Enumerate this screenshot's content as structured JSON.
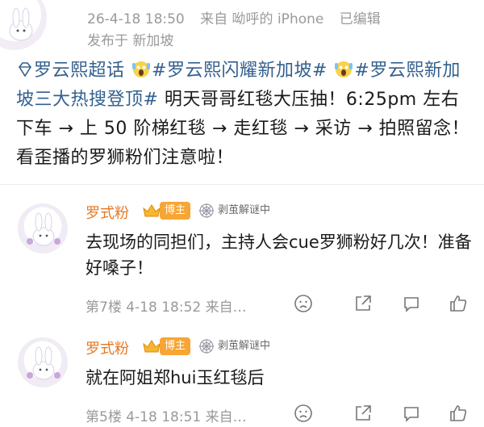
{
  "post": {
    "meta": {
      "time": "26-4-18 18:50",
      "source": "来自 呦呼的 iPhone",
      "edited": "已编辑",
      "published": "发布于 新加坡"
    },
    "body": {
      "seg1": "罗云熙超话",
      "seg2": "#罗云熙闪耀新加坡#",
      "seg3": "#罗云熙新加坡三大热搜登顶#",
      "seg4": " 明天哥哥红毯大压抽！6:25pm 左右下车 → 上 50 阶梯红毯 → 走红毯 → 采访 → 拍照留念！看歪播的罗狮粉们注意啦！"
    }
  },
  "comments": [
    {
      "name": "罗式粉",
      "badge": "博主",
      "group": "剥茧解谜中",
      "text": "去现场的同担们，主持人会cue罗狮粉好几次！准备好嗓子！",
      "floor": "第7楼",
      "time": "4-18 18:52",
      "source": "来自…"
    },
    {
      "name": "罗式粉",
      "badge": "博主",
      "group": "剥茧解谜中",
      "text": "就在阿姐郑hui玉红毯后",
      "floor": "第5楼",
      "time": "4-18 18:51",
      "source": "来自…"
    }
  ],
  "icons": {
    "diamond": "diamond-icon",
    "emoji": "scream-emoji-icon",
    "crown": "crown-icon",
    "spider": "spider-web-icon",
    "sad": "sad-face-icon",
    "share": "share-icon",
    "comment": "comment-icon",
    "like": "like-icon"
  },
  "colors": {
    "link": "#33608f",
    "username": "#e87722",
    "badge": "#f7a534",
    "meta": "#9a9a9a"
  }
}
